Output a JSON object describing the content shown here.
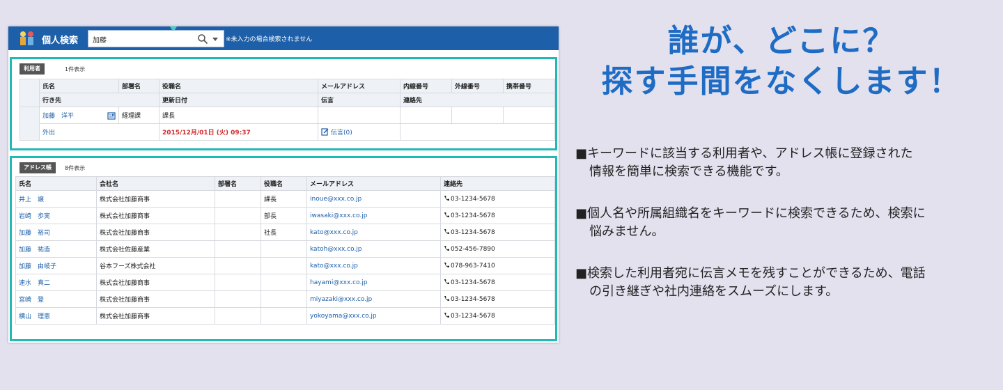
{
  "app": {
    "title": "個人検索",
    "search_value": "加藤",
    "search_note": "※未入力の場合検索されません"
  },
  "users_section": {
    "tag": "利用者",
    "count": "1件表示",
    "headers_row1": [
      "氏名",
      "部署名",
      "役職名",
      "メールアドレス",
      "内線番号",
      "外線番号",
      "携帯番号"
    ],
    "headers_row2": [
      "行き先",
      "更新日付",
      "伝言",
      "連絡先"
    ],
    "record": {
      "name": "加藤　洋平",
      "department": "経理課",
      "position": "課長",
      "status": "外出",
      "updated": "2015/12月/01日 (火) 09:37",
      "message": "伝言(0)"
    }
  },
  "address_section": {
    "tag": "アドレス帳",
    "count": "8件表示",
    "headers": [
      "氏名",
      "会社名",
      "部署名",
      "役職名",
      "メールアドレス",
      "連絡先"
    ],
    "rows": [
      {
        "name": "井上　譲",
        "company": "株式会社加藤商事",
        "dept": "",
        "position": "課長",
        "email": "inoue@xxx.co.jp",
        "phone": "03-1234-5678"
      },
      {
        "name": "岩崎　歩実",
        "company": "株式会社加藤商事",
        "dept": "",
        "position": "部長",
        "email": "iwasaki@xxx.co.jp",
        "phone": "03-1234-5678"
      },
      {
        "name": "加藤　裕司",
        "company": "株式会社加藤商事",
        "dept": "",
        "position": "社長",
        "email": "kato@xxx.co.jp",
        "phone": "03-1234-5678"
      },
      {
        "name": "加藤　祐造",
        "company": "株式会社佐藤産業",
        "dept": "",
        "position": "",
        "email": "katoh@xxx.co.jp",
        "phone": "052-456-7890"
      },
      {
        "name": "加藤　由岐子",
        "company": "谷本フーズ株式会社",
        "dept": "",
        "position": "",
        "email": "kato@xxx.co.jp",
        "phone": "078-963-7410"
      },
      {
        "name": "速水　真二",
        "company": "株式会社加藤商事",
        "dept": "",
        "position": "",
        "email": "hayami@xxx.co.jp",
        "phone": "03-1234-5678"
      },
      {
        "name": "宮崎　登",
        "company": "株式会社加藤商事",
        "dept": "",
        "position": "",
        "email": "miyazaki@xxx.co.jp",
        "phone": "03-1234-5678"
      },
      {
        "name": "横山　理恵",
        "company": "株式会社加藤商事",
        "dept": "",
        "position": "",
        "email": "yokoyama@xxx.co.jp",
        "phone": "03-1234-5678"
      }
    ]
  },
  "headline": [
    "誰が、どこに？",
    "探す手間をなくします！"
  ],
  "bullets": [
    [
      "■キーワードに該当する利用者や、アドレス帳に登録された",
      "情報を簡単に検索できる機能です。"
    ],
    [
      "■個人名や所属組織名をキーワードに検索できるため、検索に",
      "悩みません。"
    ],
    [
      "■検索した利用者宛に伝言メモを残すことができるため、電話",
      "の引き継ぎや社内連絡をスムーズにします。"
    ]
  ],
  "colors": {
    "appbar": "#1d5fa8",
    "section_border": "#22b8b5",
    "headline": "#1f6cc4",
    "background": "#e3e1ee",
    "alert": "#d12b2b"
  },
  "icons": [
    "app-logo-icon",
    "search-icon",
    "chevron-down-icon",
    "phone-icon",
    "memo-icon",
    "user-card-icon"
  ]
}
